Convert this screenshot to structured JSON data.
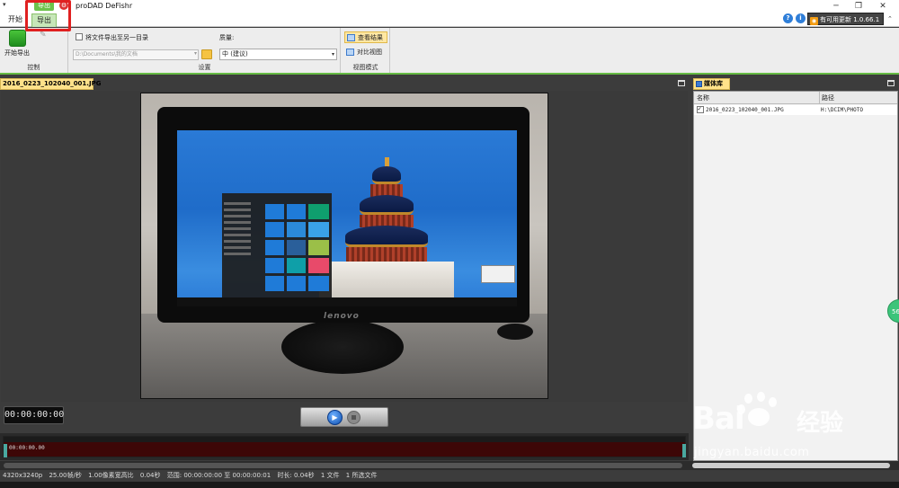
{
  "titlebar": {
    "app_title": "proDAD DeFishr",
    "sys_menu": "▾",
    "green_tab": "导出",
    "minimize": "─",
    "restore": "❐",
    "close": "✕"
  },
  "menu": {
    "tabs": [
      "开始",
      "导出"
    ],
    "active_tab": "导出",
    "help": "?",
    "info": "i",
    "update_label": "有可用更新 1.0.66.1",
    "collapse": "⌃"
  },
  "ribbon": {
    "control": {
      "start_export": "开始导出",
      "group_label": "控制"
    },
    "settings": {
      "export_to_folder": "将文件导出至另一目录",
      "path_placeholder": "D:\\Documents\\我的文档",
      "quality_label": "质量:",
      "quality_value": "中  (建议)",
      "group_label": "设置"
    },
    "view_mode": {
      "view_result": "查看结果",
      "compare_view": "对比视图",
      "group_label": "视图模式"
    }
  },
  "preview": {
    "tab_label": "2016_0223_102040_001.JPG",
    "monitor_brand": "lenovo",
    "timecode": "00:00:00:00",
    "play": "▶",
    "timeline_timecode": "00:00:00.00"
  },
  "media_library": {
    "tab_label": "媒体库",
    "columns": [
      "名称",
      "路径"
    ],
    "rows": [
      {
        "name": "2016_0223_102040_001.JPG",
        "path": "H:\\DCIM\\PHOTO",
        "checked": true
      }
    ]
  },
  "statusbar": {
    "items": [
      "4320x3240p",
      "25.00帧/秒",
      "1.00像素宽高比",
      "0.04秒",
      "范围: 00:00:00:00 至 00:00:00:01",
      "时长: 0.04秒",
      "1 文件",
      "1 所选文件"
    ]
  },
  "side_badge": "56",
  "watermark": {
    "logo": "Bai",
    "text": "经验",
    "url": "jingyan.baidu.com"
  },
  "colors": {
    "accent_green": "#66bb44",
    "tab_yellow": "#ffe28a",
    "annotation_red": "#e02020"
  }
}
